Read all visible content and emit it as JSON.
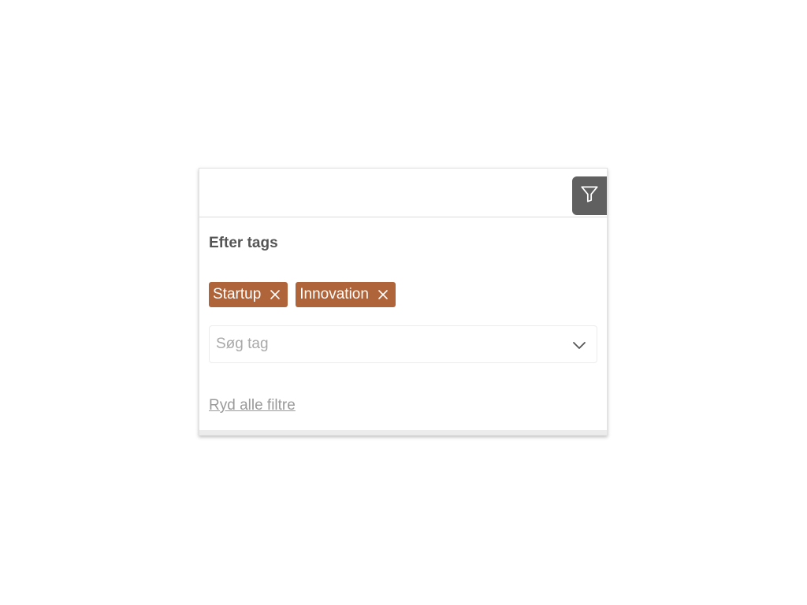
{
  "filter_panel": {
    "toggle_icon": "filter-icon",
    "section_title": "Efter tags",
    "selected_tags": [
      {
        "label": "Startup",
        "remove_icon": "close-icon"
      },
      {
        "label": "Innovation",
        "remove_icon": "close-icon"
      }
    ],
    "search": {
      "placeholder": "Søg tag",
      "value": "",
      "dropdown_icon": "chevron-down-icon"
    },
    "clear_all_label": "Ryd alle filtre"
  },
  "colors": {
    "tag_background": "#b0643a",
    "tag_text": "#ffffff",
    "filter_button": "#606060",
    "title_text": "#555555",
    "link_text": "#9a9a9a"
  }
}
